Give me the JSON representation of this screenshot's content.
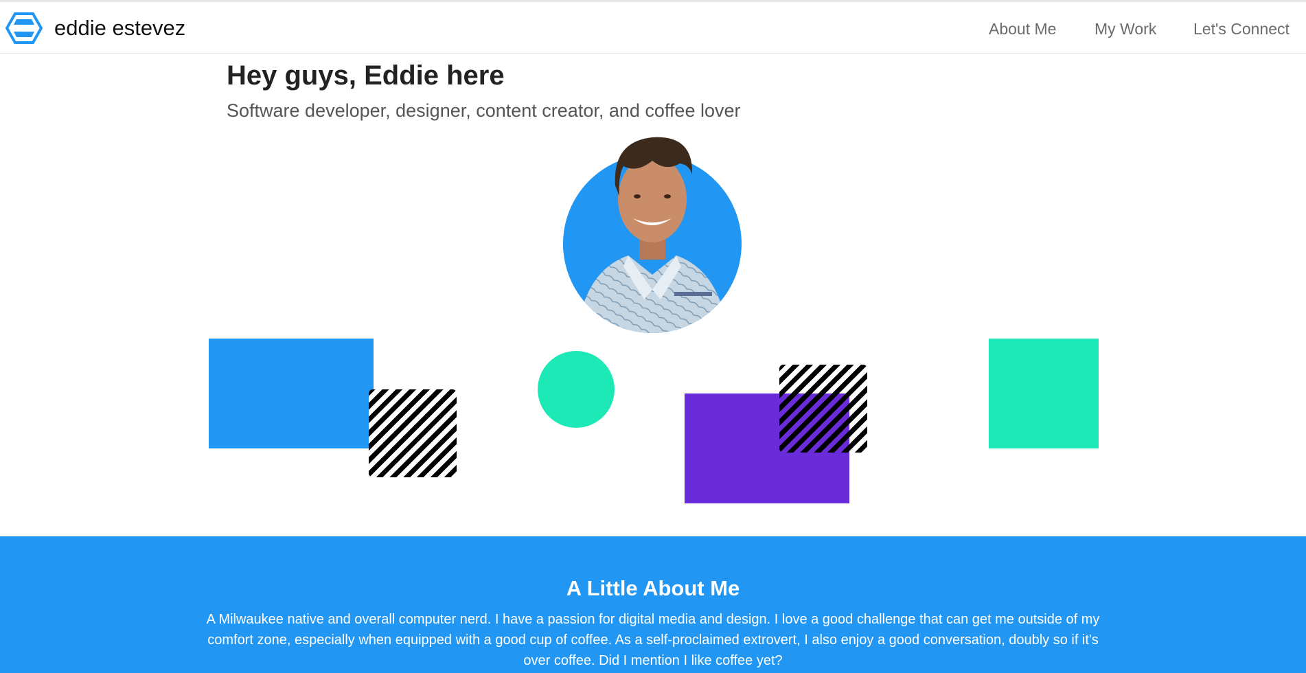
{
  "nav": {
    "brand_name": "eddie estevez",
    "links": [
      "About Me",
      "My Work",
      "Let's Connect"
    ]
  },
  "hero": {
    "title": "Hey guys, Eddie here",
    "subtitle": "Software developer, designer, content creator, and coffee lover"
  },
  "about": {
    "title": "A Little About Me",
    "body": "A Milwaukee native and overall computer nerd. I have a passion for digital media and design. I love a good challenge that can get me outside of my comfort zone, especially when equipped with a good cup of coffee. As a self-proclaimed extrovert, I also enjoy a good conversation, doubly so if it's over coffee. Did I mention I like coffee yet?"
  },
  "colors": {
    "blue": "#2196f3",
    "teal": "#1de9b6",
    "purple": "#6a2cd8",
    "stripe": "#000000"
  },
  "icons": {
    "brand_logo": "hexagon-logo-icon"
  }
}
